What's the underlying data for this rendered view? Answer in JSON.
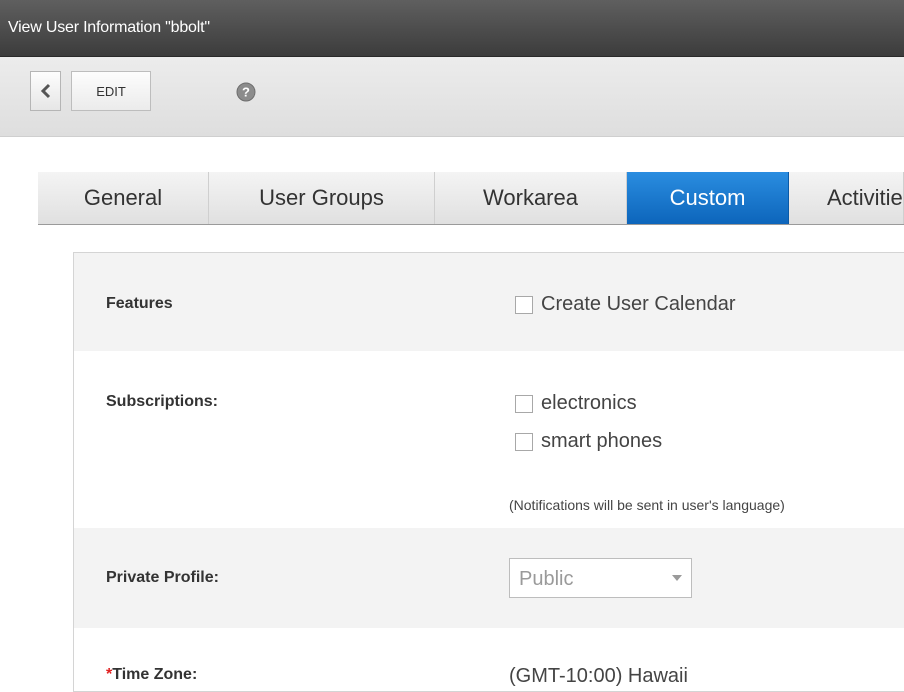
{
  "window": {
    "title": "View User Information \"bbolt\""
  },
  "toolbar": {
    "back_icon": "chevron-left-icon",
    "edit_label": "EDIT",
    "help_icon": "help-icon"
  },
  "tabs": [
    {
      "label": "General",
      "active": false
    },
    {
      "label": "User Groups",
      "active": false
    },
    {
      "label": "Workarea",
      "active": false
    },
    {
      "label": "Custom",
      "active": true
    },
    {
      "label": "Activities",
      "active": false
    }
  ],
  "form": {
    "features": {
      "label": "Features",
      "create_calendar": {
        "label": "Create User Calendar",
        "checked": false
      }
    },
    "subscriptions": {
      "label": "Subscriptions:",
      "items": [
        {
          "label": "electronics",
          "checked": false
        },
        {
          "label": "smart phones",
          "checked": false
        }
      ],
      "notice": "(Notifications will be sent in user's language)"
    },
    "private_profile": {
      "label": "Private Profile:",
      "value": "Public"
    },
    "time_zone": {
      "required_mark": "*",
      "label": "Time Zone:",
      "value": "(GMT-10:00) Hawaii"
    }
  },
  "colors": {
    "accent": "#1a78d2",
    "titlebar": "#4a4a4a",
    "required": "#e02020"
  }
}
